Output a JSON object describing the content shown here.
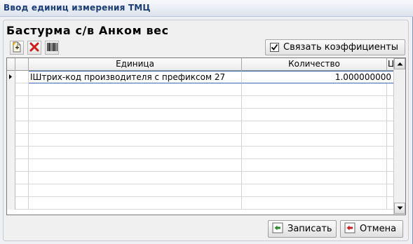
{
  "window": {
    "title": "Ввод единиц измерения ТМЦ"
  },
  "product": {
    "name": "Бастурма с/в Анком вес"
  },
  "toolbar": {
    "add_icon": "new-document-icon",
    "delete_icon": "red-x-icon",
    "barcode_icon": "barcode-icon",
    "link_label": "Связать коэффициенты",
    "link_checked": true
  },
  "grid": {
    "columns": [
      "Единица",
      "Количество",
      "Ц"
    ],
    "rows": [
      {
        "unit": "IШтрих-код производителя с префиксом 27",
        "qty": "1.000000000"
      }
    ]
  },
  "footer": {
    "save_label": "Записать",
    "cancel_label": "Отмена"
  },
  "colors": {
    "title_text": "#1a3c78",
    "selection_border": "#3d6db0",
    "delete_red": "#d21a1a",
    "save_green": "#2a8a2a"
  }
}
